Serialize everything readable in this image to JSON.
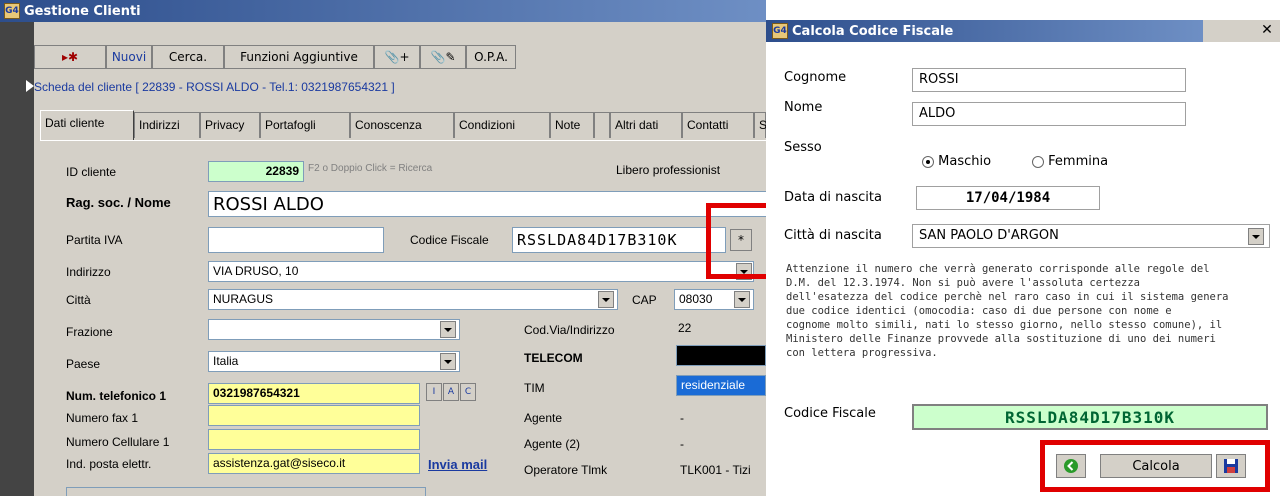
{
  "main_window": {
    "title": "Gestione Clienti",
    "toolbar": {
      "star_label": "▸✱",
      "nuovi": "Nuovi",
      "cerca": "Cerca.",
      "funzioni": "Funzioni Aggiuntive",
      "attach_add": "📎+",
      "attach_edit": "📎✎",
      "opa": "O.P.A."
    },
    "scheda": "Scheda del cliente [ 22839 - ROSSI ALDO - Tel.1: 0321987654321 ]",
    "tabs": [
      "Dati cliente",
      "Indirizzi",
      "Privacy",
      "Portafogli",
      "Conoscenza",
      "Condizioni",
      "Note",
      "Altri dati",
      "Contatti",
      "Stor"
    ],
    "form": {
      "id_label": "ID cliente",
      "id_value": "22839",
      "id_hint": "F2 o Doppio Click = Ricerca",
      "categoria": "Libero professionist",
      "ragsoc_label": "Rag. soc. / Nome",
      "ragsoc_value": "ROSSI ALDO",
      "piva_label": "Partita IVA",
      "piva_value": "",
      "cf_label": "Codice Fiscale",
      "cf_value": "RSSLDA84D17B310K",
      "cf_btn": "*",
      "indirizzo_label": "Indirizzo",
      "indirizzo_value": "VIA DRUSO, 10",
      "citta_label": "Città",
      "citta_value": "NURAGUS",
      "cap_label": "CAP",
      "cap_value": "08030",
      "frazione_label": "Frazione",
      "frazione_value": "",
      "codvia_label": "Cod.Via/Indirizzo",
      "codvia_value": "22",
      "paese_label": "Paese",
      "paese_value": "Italia",
      "telecom_label": "TELECOM",
      "tel1_label": "Num. telefonico 1",
      "tel1_value": "0321987654321",
      "tel_btns": [
        "I",
        "A",
        "C"
      ],
      "tim_label": "TIM",
      "tim_value": "residenziale",
      "fax_label": "Numero fax 1",
      "agente_label": "Agente",
      "agente_value": "-",
      "cell_label": "Numero Cellulare 1",
      "agente2_label": "Agente (2)",
      "agente2_value": "-",
      "email_label": "Ind. posta elettr.",
      "email_value": "assistenza.gat@siseco.it",
      "invia_mail": "Invia mail",
      "operatore_label": "Operatore Tlmk",
      "operatore_value": "TLK001 - Tizi"
    }
  },
  "dialog": {
    "title": "Calcola Codice Fiscale",
    "close": "✕",
    "cognome_label": "Cognome",
    "cognome_value": "ROSSI",
    "nome_label": "Nome",
    "nome_value": "ALDO",
    "sesso_label": "Sesso",
    "maschio": "Maschio",
    "femmina": "Femmina",
    "data_label": "Data di nascita",
    "data_value": "17/04/1984",
    "citta_label": "Città di nascita",
    "citta_value": "SAN PAOLO D'ARGON",
    "note": "Attenzione il numero che verrà generato corrisponde alle regole del\nD.M. del 12.3.1974. Non si può avere l'assoluta certezza\ndell'esatezza del codice perchè nel raro caso in cui il sistema genera\ndue codice identici (omocodia: caso di due persone con nome e\ncognome molto simili, nati lo stesso giorno, nello stesso comune), il\nMinistero delle Finanze provvede alla sostituzione di uno dei numeri\ncon lettera progressiva.",
    "cf_label": "Codice Fiscale",
    "cf_value": "RSSLDA84D17B310K",
    "calcola": "Calcola"
  }
}
